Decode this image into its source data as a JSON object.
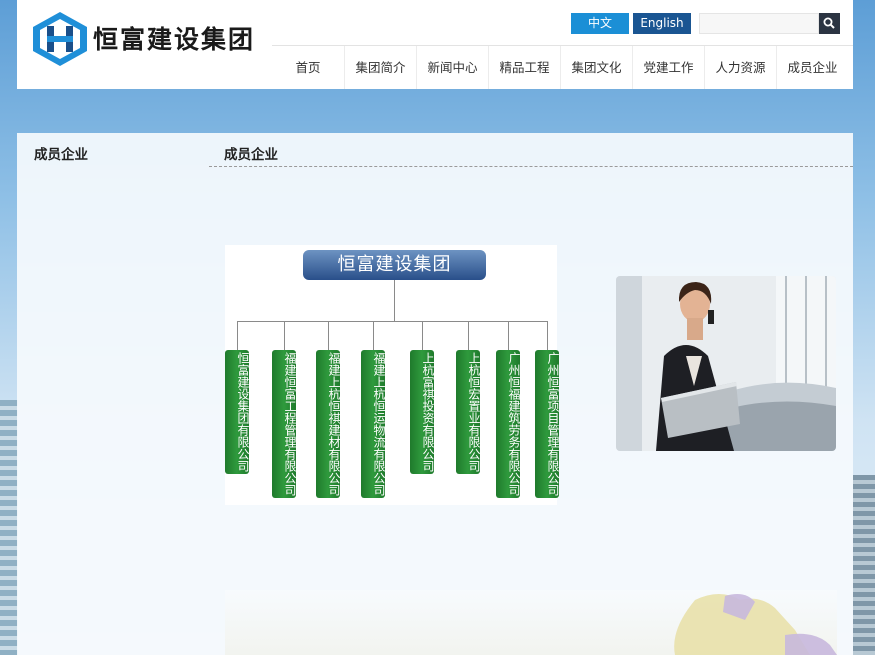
{
  "header": {
    "logo_text": "恒富建设集团",
    "lang": {
      "zh": "中文",
      "en": "English"
    },
    "search": {
      "value": "",
      "placeholder": ""
    }
  },
  "nav": {
    "items": [
      "首页",
      "集团简介",
      "新闻中心",
      "精品工程",
      "集团文化",
      "党建工作",
      "人力资源",
      "成员企业"
    ]
  },
  "sidebar": {
    "title": "成员企业"
  },
  "main": {
    "title": "成员企业",
    "org_chart": {
      "root": "恒富建设集团",
      "members": [
        "恒富建设集团有限公司",
        "福建恒富工程管理有限公司",
        "福建上杭恒祺建材有限公司",
        "福建上杭恒运物流有限公司",
        "上杭富祺投资有限公司",
        "上杭恒宏置业有限公司",
        "广州恒福建筑劳务有限公司",
        "广州恒富项目管理有限公司"
      ]
    }
  },
  "colors": {
    "lang_zh_bg": "#1b8fd6",
    "lang_en_bg": "#1a5592",
    "org_member_bg": "#2f9a3d",
    "org_root_bg": "#294f8a"
  }
}
